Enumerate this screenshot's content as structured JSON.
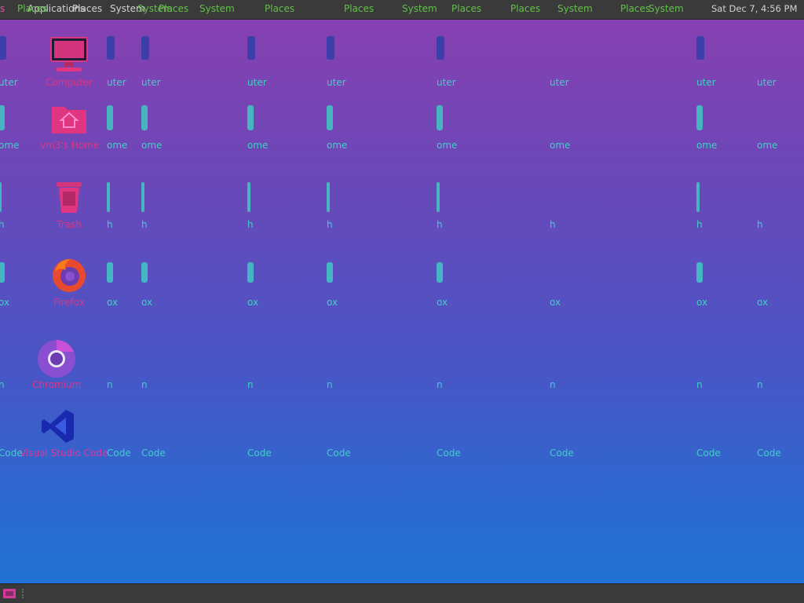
{
  "top_panel": {
    "applications": "Applications",
    "places": "Places",
    "system": "System",
    "ghost_menu_texts": [
      "Places",
      "System",
      "Places",
      "Places",
      "Places",
      "System",
      "Places",
      "Places",
      "System",
      "Places",
      "System",
      "Places"
    ],
    "clock": "Sat Dec 7, 4:56 PM"
  },
  "desktop": {
    "icons": [
      {
        "label": "Computer",
        "icon": "computer-icon"
      },
      {
        "label": "vm3's Home",
        "icon": "home-folder-icon"
      },
      {
        "label": "Trash",
        "icon": "trash-icon"
      },
      {
        "label": "Firefox",
        "icon": "firefox-icon"
      },
      {
        "label": "Chromium",
        "icon": "chromium-icon"
      },
      {
        "label": "Visual Studio Code",
        "icon": "vscode-icon"
      }
    ],
    "ghost_labels": {
      "computer": "uter",
      "home": "ome",
      "trash": "h",
      "firefox": "ox",
      "chromium": "n",
      "code": "Code"
    }
  },
  "bottom_panel": {
    "show_desktop_icon": "show-desktop-icon"
  }
}
